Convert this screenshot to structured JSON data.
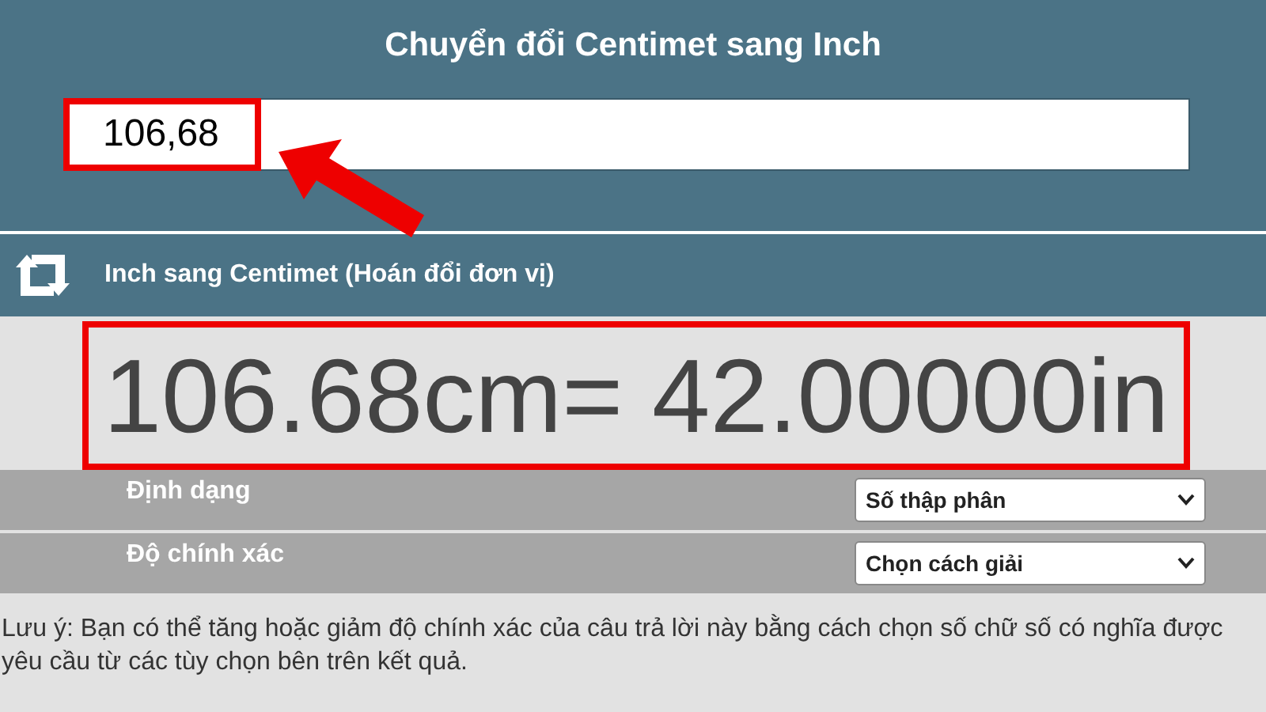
{
  "title": "Chuyển đổi Centimet sang Inch",
  "input": {
    "value": "106,68"
  },
  "swap": {
    "label": "Inch sang Centimet (Hoán đổi đơn vị)"
  },
  "result": "106.68cm= 42.00000in",
  "options": [
    {
      "label": "Định dạng",
      "value": "Số thập phân"
    },
    {
      "label": "Độ chính xác",
      "value": "Chọn cách giải"
    }
  ],
  "note": "Lưu ý: Bạn có thể tăng hoặc giảm độ chính xác của câu trả lời này bằng cách chọn số chữ số có nghĩa được yêu cầu từ các tùy chọn bên trên kết quả."
}
